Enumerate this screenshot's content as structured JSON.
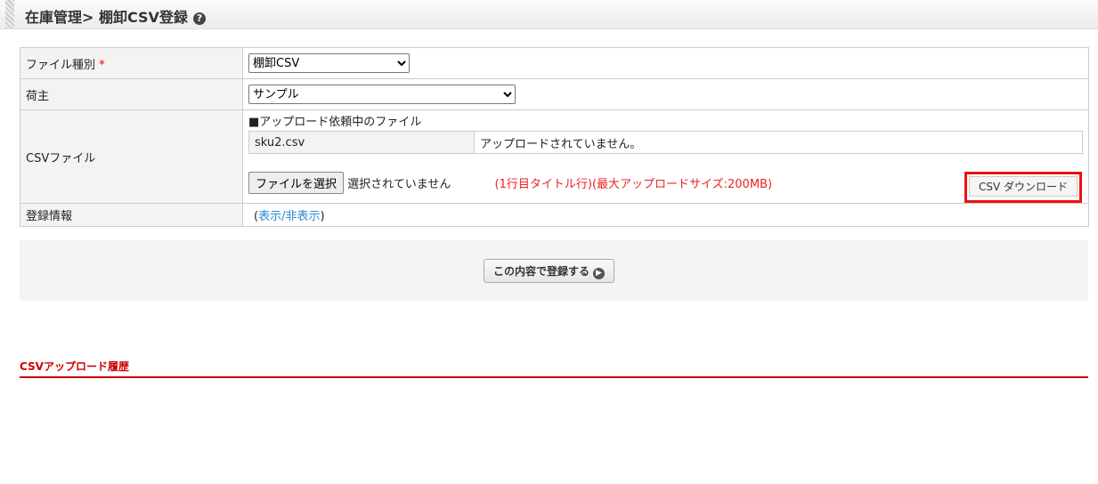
{
  "header": {
    "title": "在庫管理> 棚卸CSV登録"
  },
  "form": {
    "file_type": {
      "label": "ファイル種別",
      "required_mark": "*",
      "value": "棚卸CSV"
    },
    "shipper": {
      "label": "荷主",
      "value": "サンプル"
    },
    "csv": {
      "label": "CSVファイル",
      "pending_heading": "■アップロード依頼中のファイル",
      "pending_file": "sku2.csv",
      "pending_status": "アップロードされていません。",
      "choose_button": "ファイルを選択",
      "no_file": "選択されていません",
      "note": "(1行目タイトル行)(最大アップロードサイズ:200MB)",
      "download_button": "CSV ダウンロード"
    },
    "reg_info": {
      "label": "登録情報",
      "open": "(",
      "link": "表示/非表示",
      "close": ")"
    }
  },
  "submit": {
    "label": "この内容で登録する"
  },
  "history": {
    "title": "CSVアップロード履歴"
  }
}
